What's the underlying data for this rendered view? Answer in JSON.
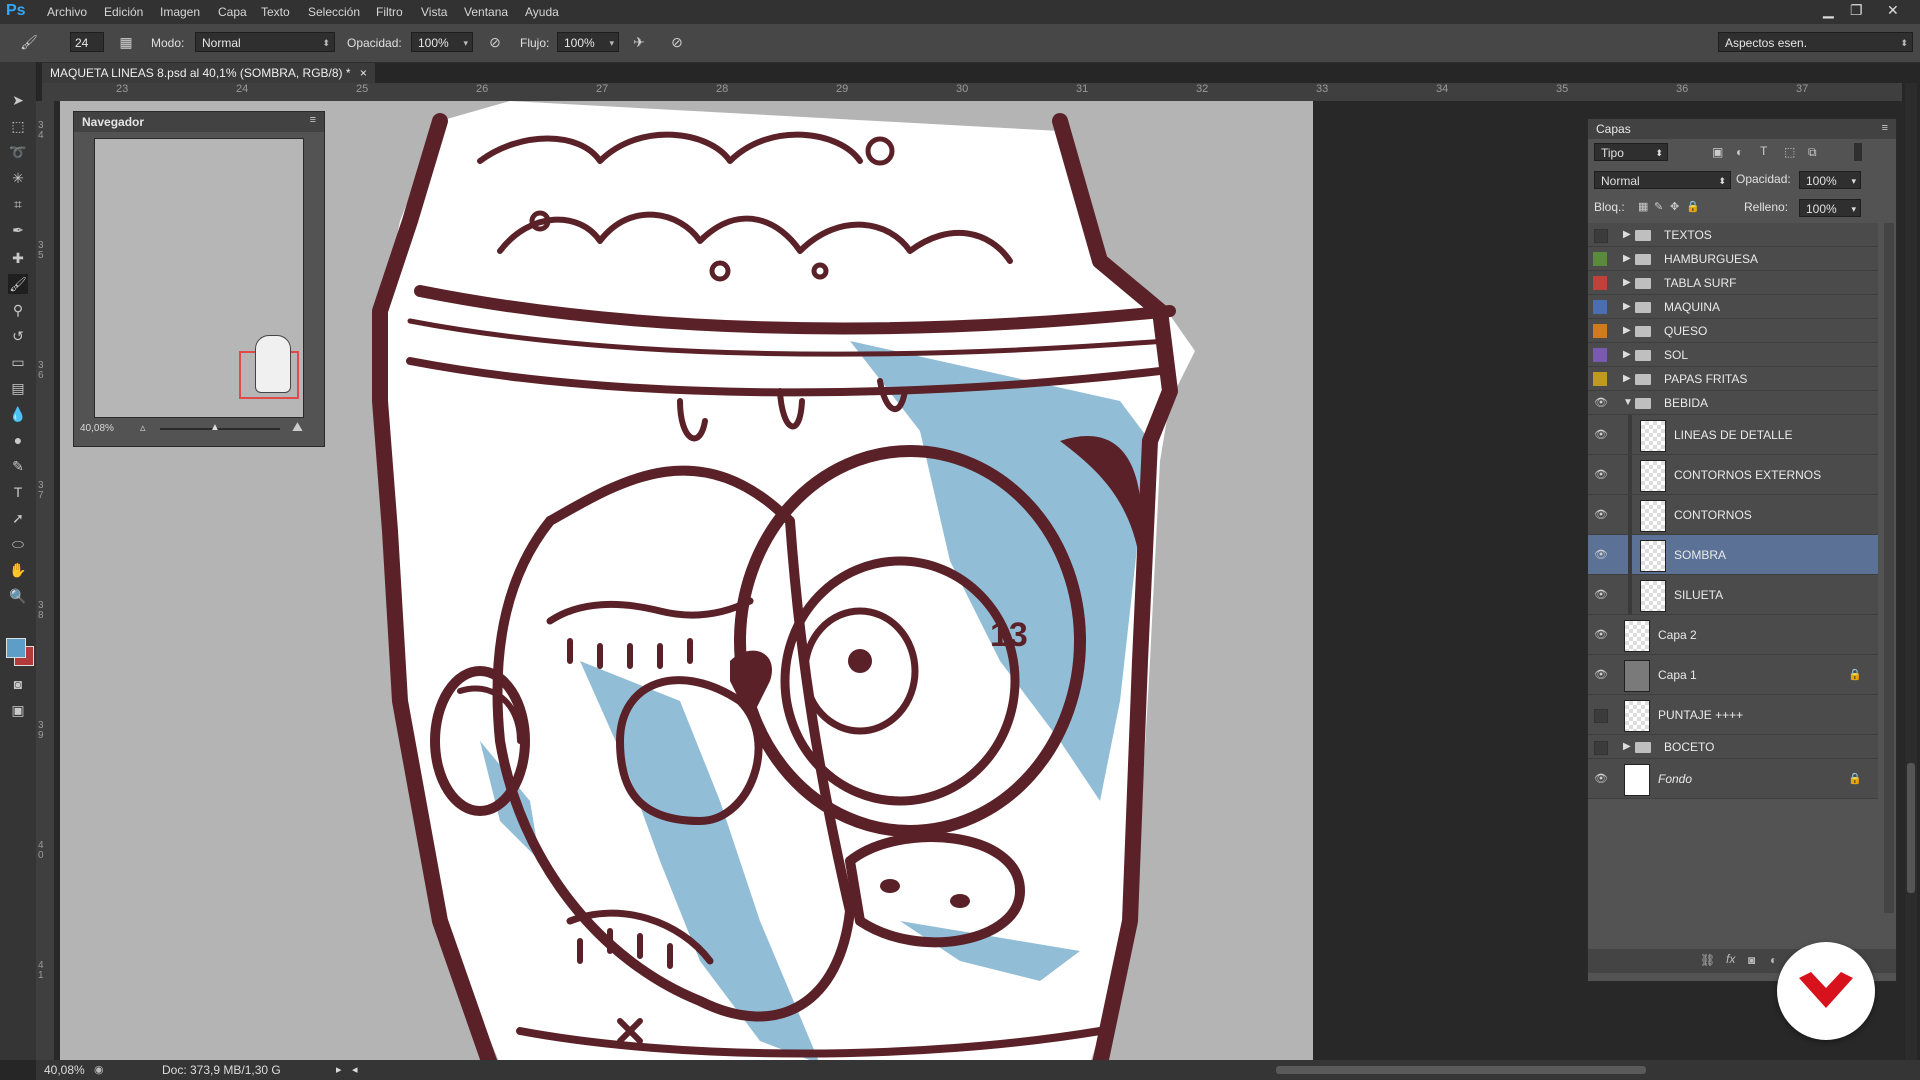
{
  "app": {
    "logo": "Ps"
  },
  "menu": [
    "Archivo",
    "Edición",
    "Imagen",
    "Capa",
    "Texto",
    "Selección",
    "Filtro",
    "Vista",
    "Ventana",
    "Ayuda"
  ],
  "options": {
    "brush_size": "24",
    "mode_label": "Modo:",
    "mode_value": "Normal",
    "opacity_label": "Opacidad:",
    "opacity_value": "100%",
    "flow_label": "Flujo:",
    "flow_value": "100%",
    "workspace": "Aspectos esen."
  },
  "document": {
    "tab_title": "MAQUETA LINEAS  8.psd al 40,1% (SOMBRA, RGB/8) *",
    "close": "×"
  },
  "ruler": {
    "top": [
      "23",
      "24",
      "25",
      "26",
      "27",
      "28",
      "29",
      "30",
      "31",
      "32",
      "33",
      "34",
      "35",
      "36",
      "37"
    ],
    "left": [
      "3\n4",
      "3\n5",
      "3\n6",
      "3\n7",
      "3\n8",
      "3\n9",
      "4\n0",
      "4\n1"
    ]
  },
  "navigator": {
    "title": "Navegador",
    "zoom": "40,08%"
  },
  "layers_panel": {
    "title": "Capas",
    "filter": "Tipo",
    "blend_mode": "Normal",
    "opacity_label": "Opacidad:",
    "opacity_value": "100%",
    "lock_label": "Bloq.:",
    "fill_label": "Relleno:",
    "fill_value": "100%",
    "layers": [
      {
        "name": "TEXTOS",
        "type": "group",
        "visible": false,
        "color": "",
        "selected": false,
        "locked": false,
        "indent": false
      },
      {
        "name": "HAMBURGUESA",
        "type": "group",
        "visible": false,
        "color": "#5a8a3c",
        "selected": false,
        "locked": false,
        "indent": false
      },
      {
        "name": "TABLA SURF",
        "type": "group",
        "visible": false,
        "color": "#c0403c",
        "selected": false,
        "locked": false,
        "indent": false
      },
      {
        "name": "MAQUINA",
        "type": "group",
        "visible": false,
        "color": "#4a6eb0",
        "selected": false,
        "locked": false,
        "indent": false
      },
      {
        "name": "QUESO",
        "type": "group",
        "visible": false,
        "color": "#d07a1e",
        "selected": false,
        "locked": false,
        "indent": false
      },
      {
        "name": "SOL",
        "type": "group",
        "visible": false,
        "color": "#7a5ab0",
        "selected": false,
        "locked": false,
        "indent": false
      },
      {
        "name": "PAPAS FRITAS",
        "type": "group",
        "visible": false,
        "color": "#c09a1e",
        "selected": false,
        "locked": false,
        "indent": false
      },
      {
        "name": "BEBIDA",
        "type": "group-open",
        "visible": true,
        "color": "",
        "selected": false,
        "locked": false,
        "indent": false
      },
      {
        "name": "LINEAS DE DETALLE",
        "type": "layer",
        "visible": true,
        "color": "",
        "selected": false,
        "locked": false,
        "indent": true
      },
      {
        "name": "CONTORNOS EXTERNOS",
        "type": "layer",
        "visible": true,
        "color": "",
        "selected": false,
        "locked": false,
        "indent": true
      },
      {
        "name": "CONTORNOS",
        "type": "layer",
        "visible": true,
        "color": "",
        "selected": false,
        "locked": false,
        "indent": true
      },
      {
        "name": "SOMBRA",
        "type": "layer",
        "visible": true,
        "color": "",
        "selected": true,
        "locked": false,
        "indent": true
      },
      {
        "name": "SILUETA",
        "type": "layer",
        "visible": true,
        "color": "",
        "selected": false,
        "locked": false,
        "indent": true
      },
      {
        "name": "Capa 2",
        "type": "layer",
        "visible": true,
        "color": "",
        "selected": false,
        "locked": false,
        "indent": false
      },
      {
        "name": "Capa 1",
        "type": "layer-gray",
        "visible": true,
        "color": "",
        "selected": false,
        "locked": true,
        "indent": false
      },
      {
        "name": "PUNTAJE ++++",
        "type": "layer",
        "visible": false,
        "color": "",
        "selected": false,
        "locked": false,
        "indent": false
      },
      {
        "name": "BOCETO",
        "type": "group",
        "visible": false,
        "color": "",
        "selected": false,
        "locked": false,
        "indent": false
      },
      {
        "name": "Fondo",
        "type": "background",
        "visible": true,
        "color": "",
        "selected": false,
        "locked": true,
        "indent": false
      }
    ]
  },
  "status": {
    "zoom": "40,08%",
    "doc": "Doc: 373,9 MB/1,30 G"
  },
  "colors": {
    "foreground": "#5c9ec8",
    "background": "#b23a3a",
    "ink": "#5a2228",
    "shadow": "#7fb2cf"
  }
}
